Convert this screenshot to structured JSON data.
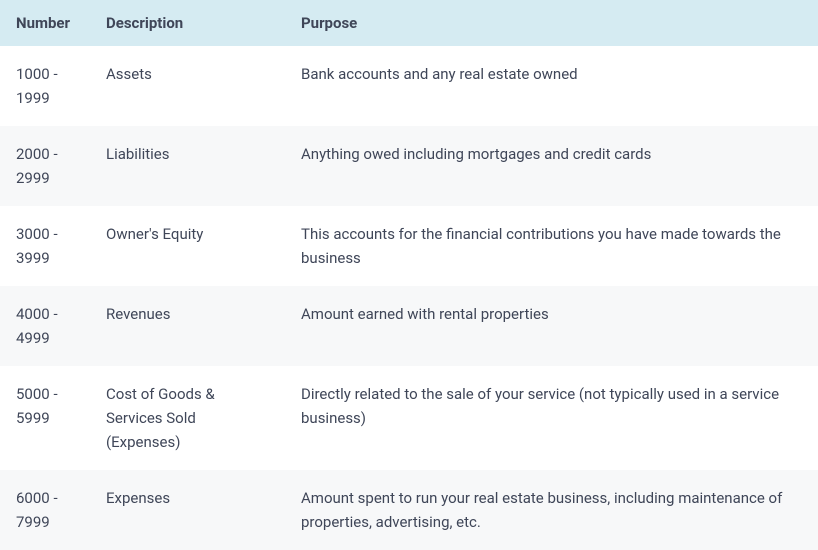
{
  "table": {
    "headers": {
      "number": "Number",
      "description": "Description",
      "purpose": "Purpose"
    },
    "rows": [
      {
        "number": "1000 - 1999",
        "description": "Assets",
        "purpose": "Bank accounts and any real estate owned"
      },
      {
        "number": "2000 - 2999",
        "description": "Liabilities",
        "purpose": "Anything owed including mortgages and credit cards"
      },
      {
        "number": "3000 - 3999",
        "description": "Owner's Equity",
        "purpose": "This accounts for the financial contributions you have made towards the business"
      },
      {
        "number": "4000 - 4999",
        "description": "Revenues",
        "purpose": "Amount earned with rental properties"
      },
      {
        "number": "5000 - 5999",
        "description": "Cost of Goods & Services Sold (Expenses)",
        "purpose": "Directly related to the sale of your service (not typically used in a service business)"
      },
      {
        "number": "6000 - 7999",
        "description": "Expenses",
        "purpose": "Amount spent to run your real estate business, including maintenance of properties, advertising, etc."
      }
    ]
  }
}
